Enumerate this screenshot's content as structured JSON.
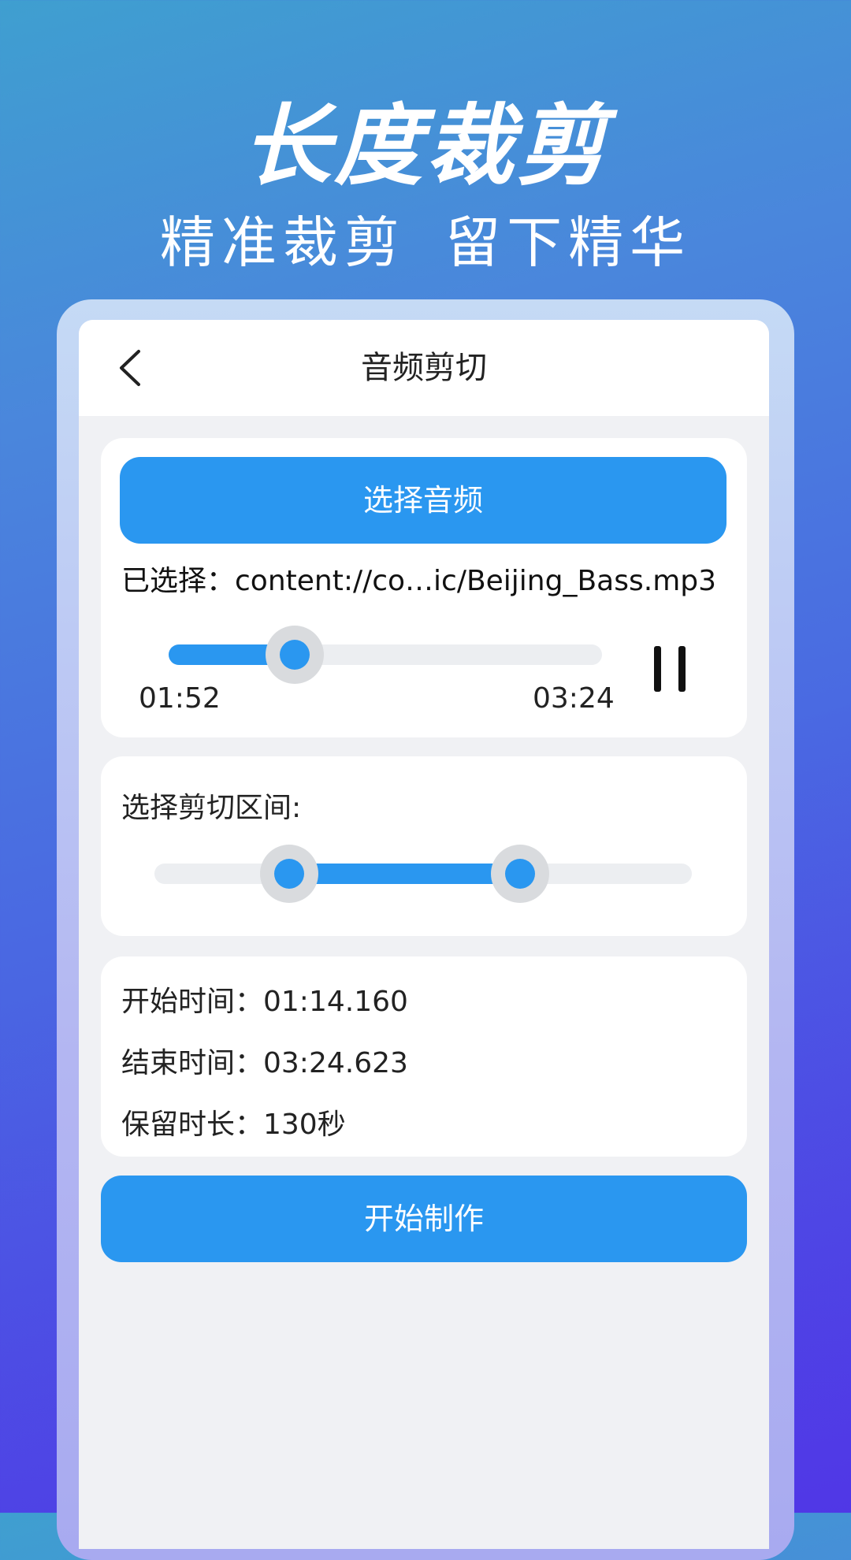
{
  "promo": {
    "title": "长度裁剪",
    "subtitle": "精准裁剪  留下精华"
  },
  "colors": {
    "accent": "#2a97f0",
    "background_top": "#3f9fd0",
    "background_bottom": "#4b3fe6"
  },
  "nav": {
    "back_icon": "chevron-left-icon",
    "title": "音频剪切"
  },
  "player": {
    "select_button_label": "选择音频",
    "selected_text": "已选择：content://co…ic/Beijing_Bass.mp3",
    "current_time": "01:52",
    "total_time": "03:24",
    "progress": 0.29,
    "pause_icon": "pause-icon"
  },
  "range": {
    "label": "选择剪切区间:",
    "start_fraction": 0.25,
    "end_fraction": 0.68
  },
  "info": {
    "start_time_text": "开始时间：01:14.160",
    "end_time_text": "结束时间：03:24.623",
    "duration_text": "保留时长：130秒"
  },
  "actions": {
    "start_button_label": "开始制作"
  }
}
